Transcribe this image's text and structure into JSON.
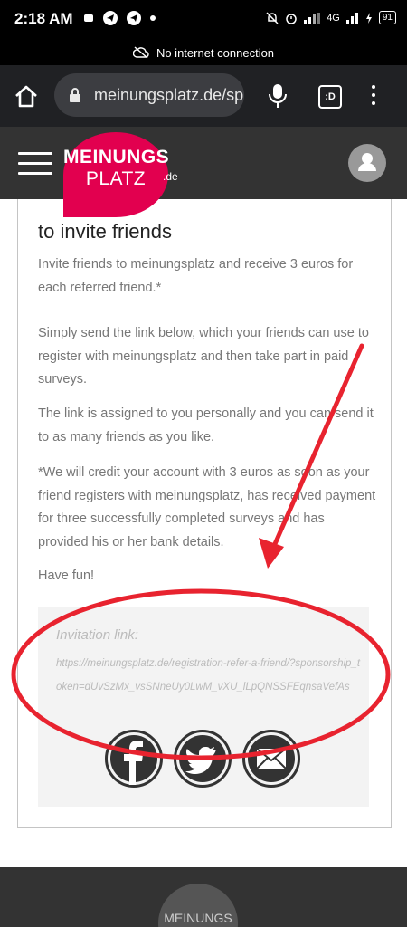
{
  "status_bar": {
    "time": "2:18 AM",
    "network": "4G",
    "battery": "91"
  },
  "offline_banner": {
    "text": "No internet connection"
  },
  "browser": {
    "url": "meinungsplatz.de/sp",
    "tab_label": ":D"
  },
  "site_header": {
    "logo_line1": "MEINUNGS",
    "logo_line2": "PLATZ",
    "logo_suffix": ".de"
  },
  "content": {
    "title": "to invite friends",
    "paragraphs": [
      "Invite friends to meinungsplatz and receive 3 euros for each referred friend.*",
      "Simply send the link below, which your friends can use to register with meinungsplatz and then take part in paid surveys.",
      "The link is assigned to you personally and you can send it to as many friends as you like.",
      "*We will credit your account with 3 euros as soon as your friend registers with meinungsplatz, has received payment for three successfully completed surveys and has provided his or her bank details.",
      "Have fun!"
    ],
    "invitation_label": "Invitation link:",
    "invitation_url": "https://meinungsplatz.de/registration-refer-a-friend/?sponsorship_token=dUvSzMx_vsSNneUy0LwM_vXU_lLpQNSSFEqnsaVefAs"
  },
  "share_buttons": [
    {
      "icon": "facebook-icon"
    },
    {
      "icon": "twitter-icon"
    },
    {
      "icon": "email-icon"
    }
  ],
  "footer": {
    "logo_text": "MEINUNGS"
  },
  "colors": {
    "brand": "#e2004f",
    "header": "#333333",
    "annotation": "#e8232f"
  }
}
